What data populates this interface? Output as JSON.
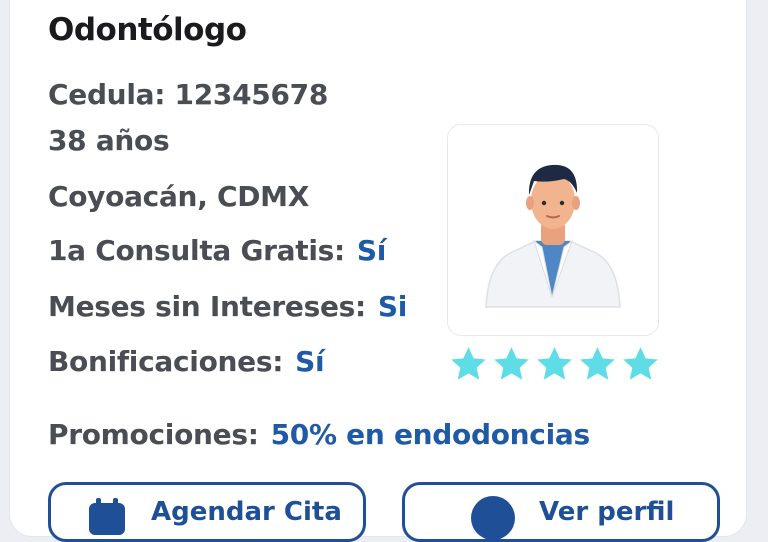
{
  "profile": {
    "title": "Odontólogo",
    "cedula": "Cedula: 12345678",
    "age": "38 años",
    "location": "Coyoacán, CDMX",
    "free_consult_label": "1a Consulta Gratis:",
    "free_consult_value": "Sí",
    "msi_label": "Meses sin Intereses:",
    "msi_value": "Si",
    "bonus_label": "Bonificaciones:",
    "bonus_value": "Sí",
    "promo_label": "Promociones:",
    "promo_value": "50% en endodoncias"
  },
  "rating": {
    "stars": 5,
    "max": 5,
    "color": "#5fdde6"
  },
  "buttons": {
    "appointment_label": "Agendar Cita",
    "appointment_icon": "calendar-icon",
    "profile_label": "Ver perfil",
    "profile_icon": "profile-icon"
  },
  "colors": {
    "accent": "#1f5aa6",
    "text": "#4a4d54",
    "title": "#1b1b1f",
    "button_border": "#1f4f96"
  }
}
